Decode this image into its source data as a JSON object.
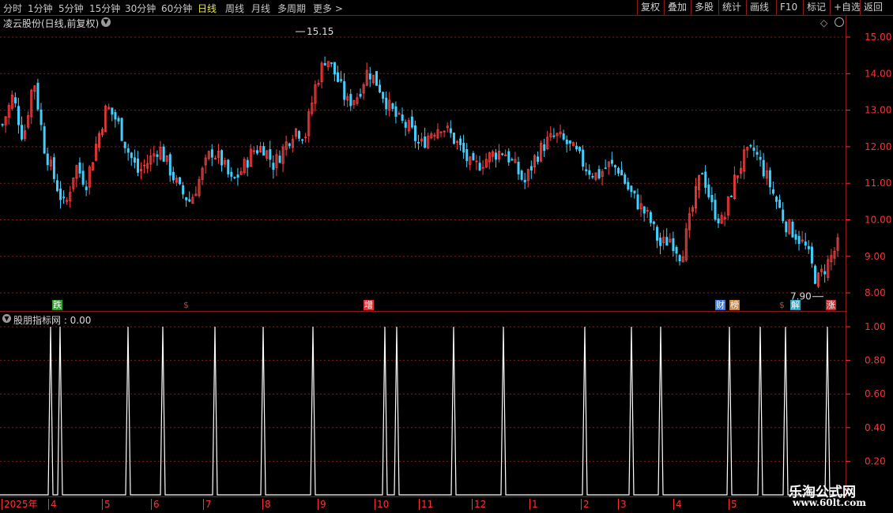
{
  "toolbar": {
    "periods": [
      "分时",
      "1分钟",
      "5分钟",
      "15分钟",
      "30分钟",
      "60分钟",
      "日线",
      "周线",
      "月线",
      "多周期",
      "更多 >"
    ],
    "active_period": "日线",
    "right_buttons": [
      "复权",
      "叠加",
      "多股",
      "统计",
      "画线",
      "F10",
      "标记",
      "+自选",
      "返回"
    ]
  },
  "main_chart": {
    "title": "凌云股份(日线,前复权)",
    "high_label": "15.15",
    "low_label": "7.90",
    "markers": [
      {
        "label": "跌",
        "color": "#2aa02a"
      },
      {
        "label": "$",
        "color": "#e03030"
      },
      {
        "label": "增",
        "color": "#e03030"
      },
      {
        "label": "财",
        "color": "#3a7adf"
      },
      {
        "label": "榜",
        "color": "#d08030"
      },
      {
        "label": "$",
        "color": "#e03030"
      },
      {
        "label": "解",
        "color": "#30a0c0"
      },
      {
        "label": "涨",
        "color": "#c03030"
      }
    ],
    "y_ticks": [
      "15.00",
      "14.00",
      "13.00",
      "12.00",
      "11.00",
      "10.00",
      "9.00",
      "8.00"
    ],
    "colors": {
      "up": "#ff4040",
      "down": "#40d0ff",
      "axis": "#ff3030",
      "grid": "#8a1a1a"
    }
  },
  "indicator": {
    "title": "股朋指标网 : 0.00",
    "y_ticks": [
      "1.00",
      "0.80",
      "0.60",
      "0.40",
      "0.20"
    ]
  },
  "date_axis": {
    "labels": [
      "2025年",
      "4",
      "5",
      "6",
      "7",
      "8",
      "9",
      "10",
      "11",
      "12",
      "1",
      "2",
      "3",
      "4",
      "5"
    ]
  },
  "watermark": {
    "line1": "乐淘公式网",
    "line2": "www.60lt.com"
  },
  "chart_data": [
    {
      "type": "candlestick",
      "title": "凌云股份(日线,前复权)",
      "ylim": [
        7.6,
        15.3
      ],
      "y_ticks": [
        15,
        14,
        13,
        12,
        11,
        10,
        9,
        8
      ],
      "annotations": [
        {
          "text": "15.15",
          "type": "max"
        },
        {
          "text": "7.90",
          "type": "min"
        }
      ],
      "close_path": [
        12.6,
        13.4,
        12.2,
        13.9,
        12.0,
        11.1,
        10.3,
        11.5,
        11.0,
        12.1,
        13.1,
        12.7,
        11.9,
        11.3,
        11.6,
        12.0,
        11.4,
        10.8,
        10.5,
        11.2,
        11.9,
        11.6,
        11.0,
        11.4,
        11.9,
        12.0,
        11.5,
        12.0,
        12.5,
        12.3,
        13.7,
        14.5,
        13.9,
        13.2,
        13.4,
        14.1,
        13.7,
        13.1,
        12.7,
        12.5,
        12.0,
        12.4,
        12.6,
        12.3,
        11.9,
        11.4,
        11.6,
        11.8,
        11.9,
        11.5,
        11.0,
        11.7,
        12.1,
        12.3,
        12.1,
        11.8,
        11.4,
        11.2,
        11.5,
        11.4,
        10.8,
        10.4,
        10.0,
        9.3,
        9.5,
        9.0,
        10.2,
        11.4,
        10.3,
        9.9,
        11.0,
        11.7,
        11.9,
        11.3,
        10.6,
        9.9,
        9.6,
        9.2,
        8.3,
        8.8,
        9.3
      ]
    },
    {
      "type": "line",
      "title": "股朋指标网 : 0.00",
      "ylim": [
        0,
        1.0
      ],
      "y_ticks": [
        1.0,
        0.8,
        0.6,
        0.4,
        0.2
      ],
      "spike_count": 18,
      "baseline": 0,
      "peak": 1.0
    }
  ]
}
